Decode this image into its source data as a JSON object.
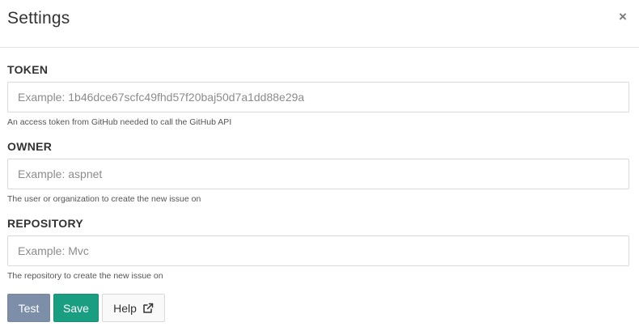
{
  "dialog": {
    "title": "Settings",
    "close_label": "×"
  },
  "fields": {
    "token": {
      "label": "TOKEN",
      "placeholder": "Example: 1b46dce67scfc49fhd57f20baj50d7a1dd88e29a",
      "value": "",
      "help": "An access token from GitHub needed to call the GitHub API"
    },
    "owner": {
      "label": "OWNER",
      "placeholder": "Example: aspnet",
      "value": "",
      "help": "The user or organization to create the new issue on"
    },
    "repository": {
      "label": "REPOSITORY",
      "placeholder": "Example: Mvc",
      "value": "",
      "help": "The repository to create the new issue on"
    }
  },
  "buttons": {
    "test_label": "Test",
    "save_label": "Save",
    "help_label": "Help",
    "help_icon": "external-link-icon"
  },
  "colors": {
    "test_button": "#7d8fa8",
    "save_button": "#1a9e82",
    "help_button": "#f9f9f9"
  }
}
